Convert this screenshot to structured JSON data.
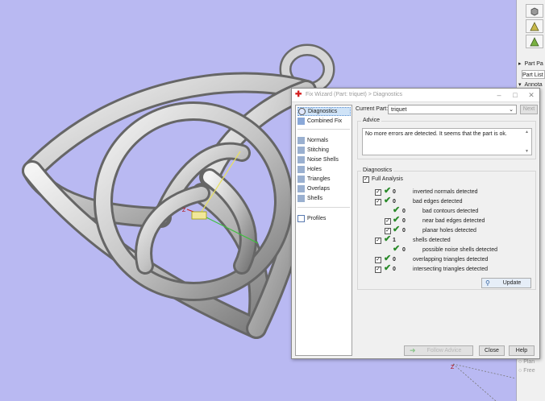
{
  "right_panel": {
    "part_pane_label": "Part Pa",
    "part_list_label": "Part List",
    "annotations_label": "Annota",
    "bottom_items": [
      "Plan",
      "Free"
    ]
  },
  "dialog": {
    "title": "Fix Wizard (Part: triquet) > Diagnostics",
    "nav_items": [
      {
        "label": "Diagnostics",
        "icon": "diagnostics-icon"
      },
      {
        "label": "Combined Fix",
        "icon": "combined-fix-icon"
      },
      {
        "label": "Normals",
        "icon": "normals-icon"
      },
      {
        "label": "Stitching",
        "icon": "stitching-icon"
      },
      {
        "label": "Noise Shells",
        "icon": "noise-shells-icon"
      },
      {
        "label": "Holes",
        "icon": "holes-icon"
      },
      {
        "label": "Triangles",
        "icon": "triangles-icon"
      },
      {
        "label": "Overlaps",
        "icon": "overlaps-icon"
      },
      {
        "label": "Shells",
        "icon": "shells-icon"
      },
      {
        "label": "Profiles",
        "icon": "profiles-icon"
      }
    ],
    "current_part_label": "Current Part:",
    "current_part_value": "triquet",
    "next_button": "Next",
    "advice_title": "Advice",
    "advice_text": "No more errors are detected. It seems that the part is ok.",
    "diagnostics_title": "Diagnostics",
    "full_analysis_label": "Full Analysis",
    "rows": [
      {
        "count": "0",
        "label": "inverted normals detected",
        "indent": 0,
        "checkbox": true
      },
      {
        "count": "0",
        "label": "bad edges detected",
        "indent": 0,
        "checkbox": true
      },
      {
        "count": "0",
        "label": "bad contours detected",
        "indent": 1,
        "checkbox": true
      },
      {
        "count": "0",
        "label": "near bad edges detected",
        "indent": 1,
        "checkbox": true
      },
      {
        "count": "0",
        "label": "planar holes detected",
        "indent": 1,
        "checkbox": true
      },
      {
        "count": "1",
        "label": "shells detected",
        "indent": 0,
        "checkbox": true
      },
      {
        "count": "0",
        "label": "possible noise shells detected",
        "indent": 1,
        "checkbox": false
      },
      {
        "count": "0",
        "label": "overlapping triangles detected",
        "indent": 0,
        "checkbox": true
      },
      {
        "count": "0",
        "label": "intersecting triangles detected",
        "indent": 0,
        "checkbox": true
      }
    ],
    "update_button": "Update",
    "follow_advice_button": "Follow Advice",
    "close_button": "Close",
    "help_button": "Help"
  },
  "viewport": {
    "axis_label_z": "Z",
    "axis_label_bottom": "Z"
  }
}
